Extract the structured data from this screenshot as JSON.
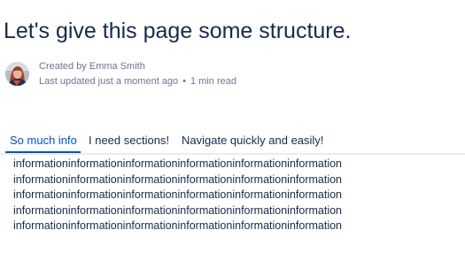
{
  "page": {
    "title": "Let's give this page some structure."
  },
  "byline": {
    "created_by": "Created by Emma Smith",
    "last_updated": "Last updated just a moment ago",
    "separator": "•",
    "read_time": "1 min read",
    "avatar_icon": "user-avatar-photo"
  },
  "tabs": [
    {
      "label": "So much info",
      "active": true
    },
    {
      "label": "I need sections!",
      "active": false
    },
    {
      "label": "Navigate quickly and easily!",
      "active": false
    }
  ],
  "content": {
    "lines": [
      "informationinformationinformationinformationinformationinformation",
      "informationinformationinformationinformationinformationinformation",
      "informationinformationinformationinformationinformationinformation",
      "informationinformationinformationinformationinformationinformation",
      "informationinformationinformationinformationinformationinformation"
    ]
  },
  "colors": {
    "text": "#172b4d",
    "muted": "#6b778c",
    "accent": "#0052cc",
    "divider": "#ebecf0"
  }
}
